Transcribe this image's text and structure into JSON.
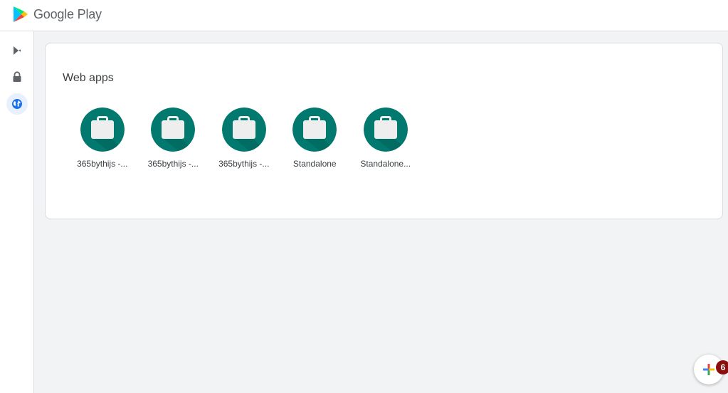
{
  "header": {
    "brand": "Google Play",
    "logo_icon": "google-play-logo-icon"
  },
  "sidebar": {
    "items": [
      {
        "icon": "play-store-icon",
        "active": false
      },
      {
        "icon": "lock-icon",
        "active": false
      },
      {
        "icon": "globe-icon",
        "active": true
      }
    ]
  },
  "main": {
    "section_title": "Web apps",
    "apps": [
      {
        "label": "365bythijs -...",
        "icon": "briefcase-icon"
      },
      {
        "label": "365bythijs -...",
        "icon": "briefcase-icon"
      },
      {
        "label": "365bythijs -...",
        "icon": "briefcase-icon"
      },
      {
        "label": "Standalone",
        "icon": "briefcase-icon"
      },
      {
        "label": "Standalone...",
        "icon": "briefcase-icon"
      }
    ]
  },
  "fab": {
    "icon": "plus-icon",
    "badge": "6"
  },
  "colors": {
    "app_icon_bg": "#01796f",
    "accent": "#1a73e8",
    "badge": "#8b0e0e",
    "page_bg": "#f1f3f4"
  }
}
